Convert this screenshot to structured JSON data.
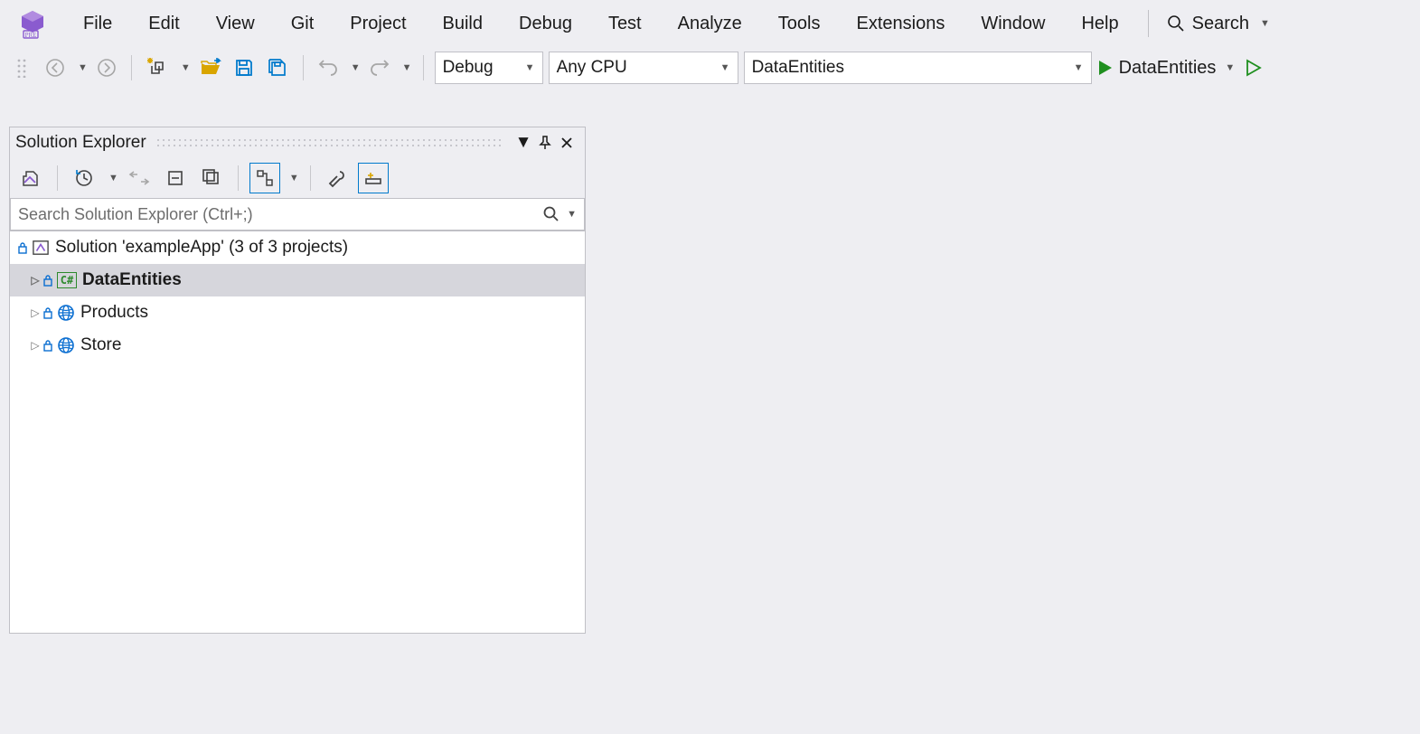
{
  "menu": {
    "file": "File",
    "edit": "Edit",
    "view": "View",
    "git": "Git",
    "project": "Project",
    "build": "Build",
    "debug": "Debug",
    "test": "Test",
    "analyze": "Analyze",
    "tools": "Tools",
    "extensions": "Extensions",
    "window": "Window",
    "help": "Help",
    "search": "Search"
  },
  "toolbar": {
    "config": "Debug",
    "platform": "Any CPU",
    "startup_project": "DataEntities",
    "run_label": "DataEntities"
  },
  "panel": {
    "title": "Solution Explorer",
    "search_placeholder": "Search Solution Explorer (Ctrl+;)"
  },
  "tree": {
    "solution_label": "Solution 'exampleApp' (3 of 3 projects)",
    "items": [
      {
        "label": "DataEntities",
        "type": "csharp",
        "selected": true
      },
      {
        "label": "Products",
        "type": "web",
        "selected": false
      },
      {
        "label": "Store",
        "type": "web",
        "selected": false
      }
    ]
  }
}
